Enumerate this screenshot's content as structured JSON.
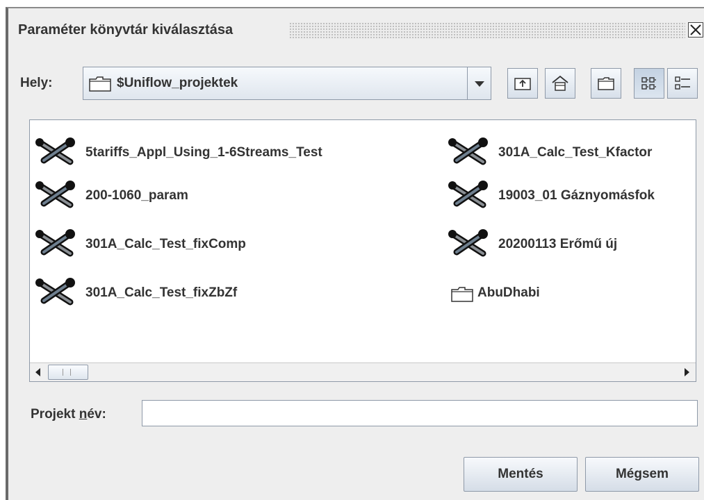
{
  "window": {
    "title": "Paraméter könyvtár kiválasztása"
  },
  "location": {
    "label": "Hely:",
    "current": "$Uniflow_projektek"
  },
  "toolbar": {
    "icons": [
      "up-folder-icon",
      "home-icon",
      "new-folder-icon",
      "list-view-icon",
      "details-view-icon"
    ]
  },
  "files": [
    {
      "name": "5tariffs_Appl_Using_1-6Streams_Test",
      "type": "project"
    },
    {
      "name": "200-1060_param",
      "type": "project"
    },
    {
      "name": "301A_Calc_Test_fixComp",
      "type": "project"
    },
    {
      "name": "301A_Calc_Test_fixZbZf",
      "type": "project"
    },
    {
      "name": "301A_Calc_Test_Kfactor",
      "type": "project"
    },
    {
      "name": "19003_01 Gáznyomásfok",
      "type": "project"
    },
    {
      "name": "20200113 Erőmű új",
      "type": "project"
    },
    {
      "name": "AbuDhabi",
      "type": "folder"
    }
  ],
  "project_name": {
    "label_pre": "Projekt ",
    "label_mnemonic": "n",
    "label_post": "év:",
    "value": ""
  },
  "buttons": {
    "save": "Mentés",
    "cancel": "Mégsem"
  }
}
